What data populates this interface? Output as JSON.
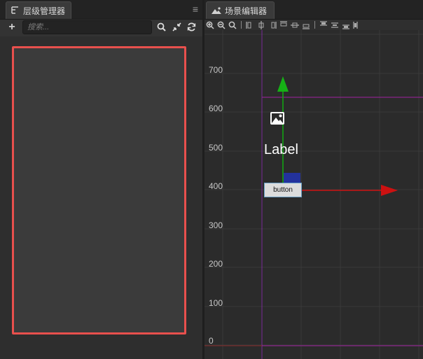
{
  "hierarchy": {
    "tab_title": "层级管理器",
    "menu_glyph": "≡",
    "add_glyph": "+",
    "search_placeholder": "搜索..."
  },
  "scene": {
    "tab_title": "场景编辑器",
    "y_axis_labels": [
      "700",
      "600",
      "500",
      "400",
      "300",
      "200",
      "100",
      "0"
    ],
    "label_node_text": "Label",
    "button_node_text": "button",
    "colors": {
      "x_axis": "#cc1111",
      "y_axis": "#11aa11",
      "design_bounds": "#a020a0",
      "selection_border": "#e8504d"
    }
  }
}
